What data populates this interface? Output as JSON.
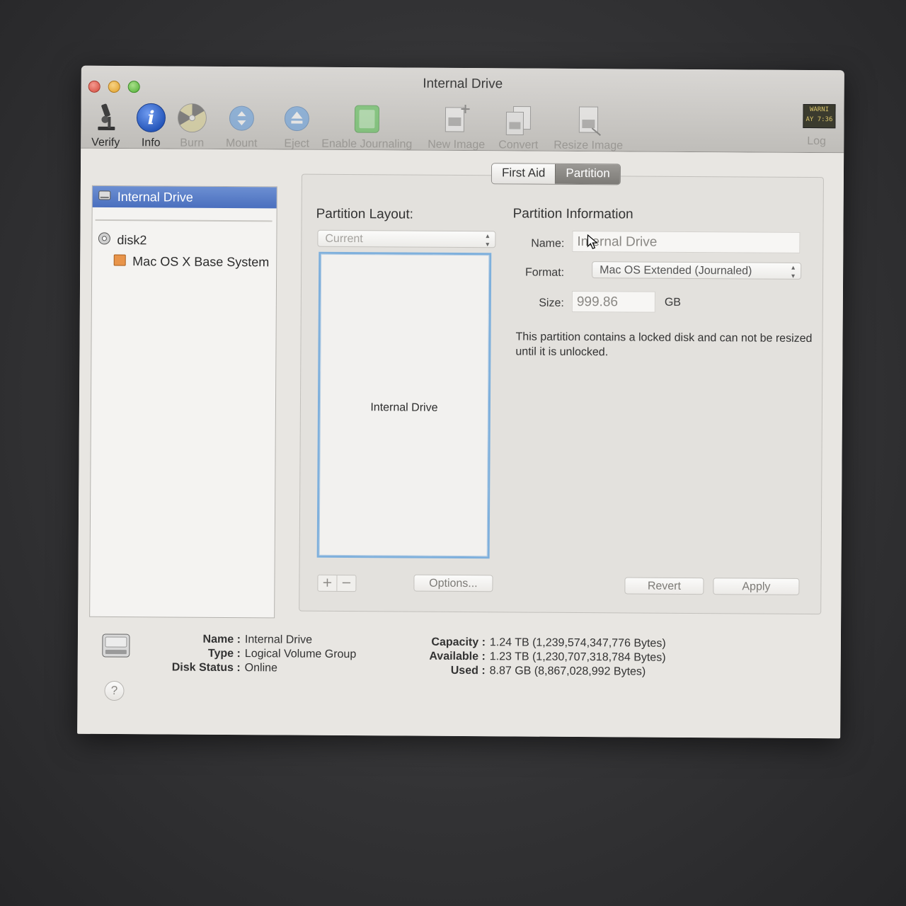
{
  "window": {
    "title": "Internal Drive"
  },
  "toolbar": {
    "verify": "Verify",
    "info": "Info",
    "burn": "Burn",
    "mount": "Mount",
    "eject": "Eject",
    "enable_journaling": "Enable Journaling",
    "new_image": "New Image",
    "convert": "Convert",
    "resize_image": "Resize Image",
    "log": "Log",
    "log_icon_text_1": "WARNI",
    "log_icon_text_2": "AY 7:36"
  },
  "sidebar": {
    "items": [
      {
        "label": "Internal Drive",
        "selected": true
      },
      {
        "label": "disk2",
        "selected": false
      },
      {
        "label": "Mac OS X Base System",
        "selected": false
      }
    ]
  },
  "tabs": {
    "first_aid": "First Aid",
    "partition": "Partition",
    "active": "Partition"
  },
  "layout": {
    "title": "Partition Layout:",
    "selected": "Current",
    "partition_name": "Internal Drive",
    "add": "+",
    "remove": "−",
    "options": "Options..."
  },
  "partition_info": {
    "title": "Partition Information",
    "name_label": "Name:",
    "name_value": "Internal Drive",
    "format_label": "Format:",
    "format_value": "Mac OS Extended (Journaled)",
    "size_label": "Size:",
    "size_value": "999.86",
    "size_unit": "GB",
    "note": "This partition contains a locked disk and can not be resized until it is unlocked.",
    "revert": "Revert",
    "apply": "Apply"
  },
  "disk_info": {
    "name_label": "Name :",
    "name_value": "Internal Drive",
    "type_label": "Type :",
    "type_value": "Logical Volume Group",
    "status_label": "Disk Status :",
    "status_value": "Online",
    "capacity_label": "Capacity :",
    "capacity_value": "1.24 TB (1,239,574,347,776 Bytes)",
    "available_label": "Available :",
    "available_value": "1.23 TB (1,230,707,318,784 Bytes)",
    "used_label": "Used :",
    "used_value": "8.87 GB (8,867,028,992 Bytes)"
  },
  "help": "?",
  "colors": {
    "selection": "#4a6fbe",
    "layout_border": "#7fb0dc",
    "info_icon": "#3b6fd1"
  }
}
